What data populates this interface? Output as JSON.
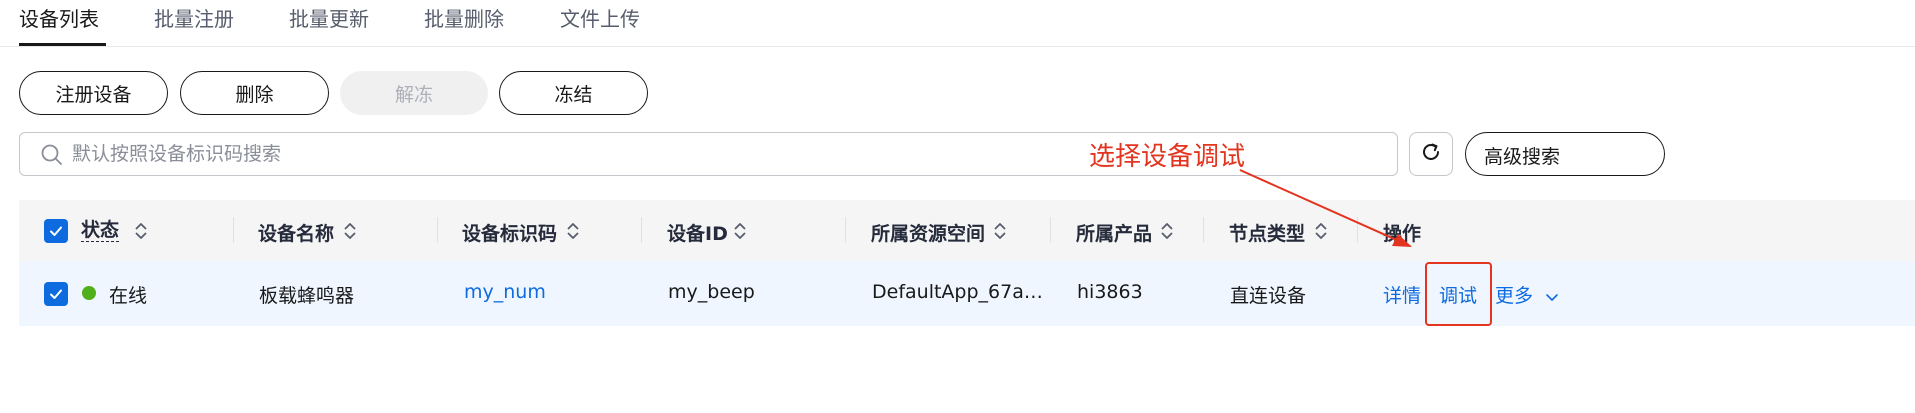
{
  "tabs": [
    {
      "label": "设备列表",
      "active": true
    },
    {
      "label": "批量注册"
    },
    {
      "label": "批量更新"
    },
    {
      "label": "批量删除"
    },
    {
      "label": "文件上传"
    }
  ],
  "toolbar": {
    "register": "注册设备",
    "delete": "删除",
    "unfreeze": "解冻",
    "freeze": "冻结"
  },
  "search": {
    "placeholder": "默认按照设备标识码搜索",
    "value": "",
    "advanced_label": "高级搜索"
  },
  "icons": {
    "search": "search-icon",
    "refresh": "refresh-icon",
    "sort": "sort-icon",
    "check": "check-icon",
    "chevron": "chevron-down-icon"
  },
  "table": {
    "columns": [
      "状态",
      "设备名称",
      "设备标识码",
      "设备ID",
      "所属资源空间",
      "所属产品",
      "节点类型",
      "操作"
    ],
    "rows": [
      {
        "checked": true,
        "status": "在线",
        "status_color": "#50b01b",
        "name": "板载蜂鸣器",
        "identifier": "my_num",
        "device_id": "my_beep",
        "resource_space": "DefaultApp_67a…",
        "product": "hi3863",
        "node_type": "直连设备",
        "actions": {
          "details": "详情",
          "debug": "调试",
          "more": "更多"
        }
      }
    ]
  },
  "annotation": {
    "text": "选择设备调试",
    "color": "#e3341f"
  },
  "colors": {
    "accent": "#0d6bdf",
    "online": "#50b01b",
    "annotation": "#e3341f"
  }
}
